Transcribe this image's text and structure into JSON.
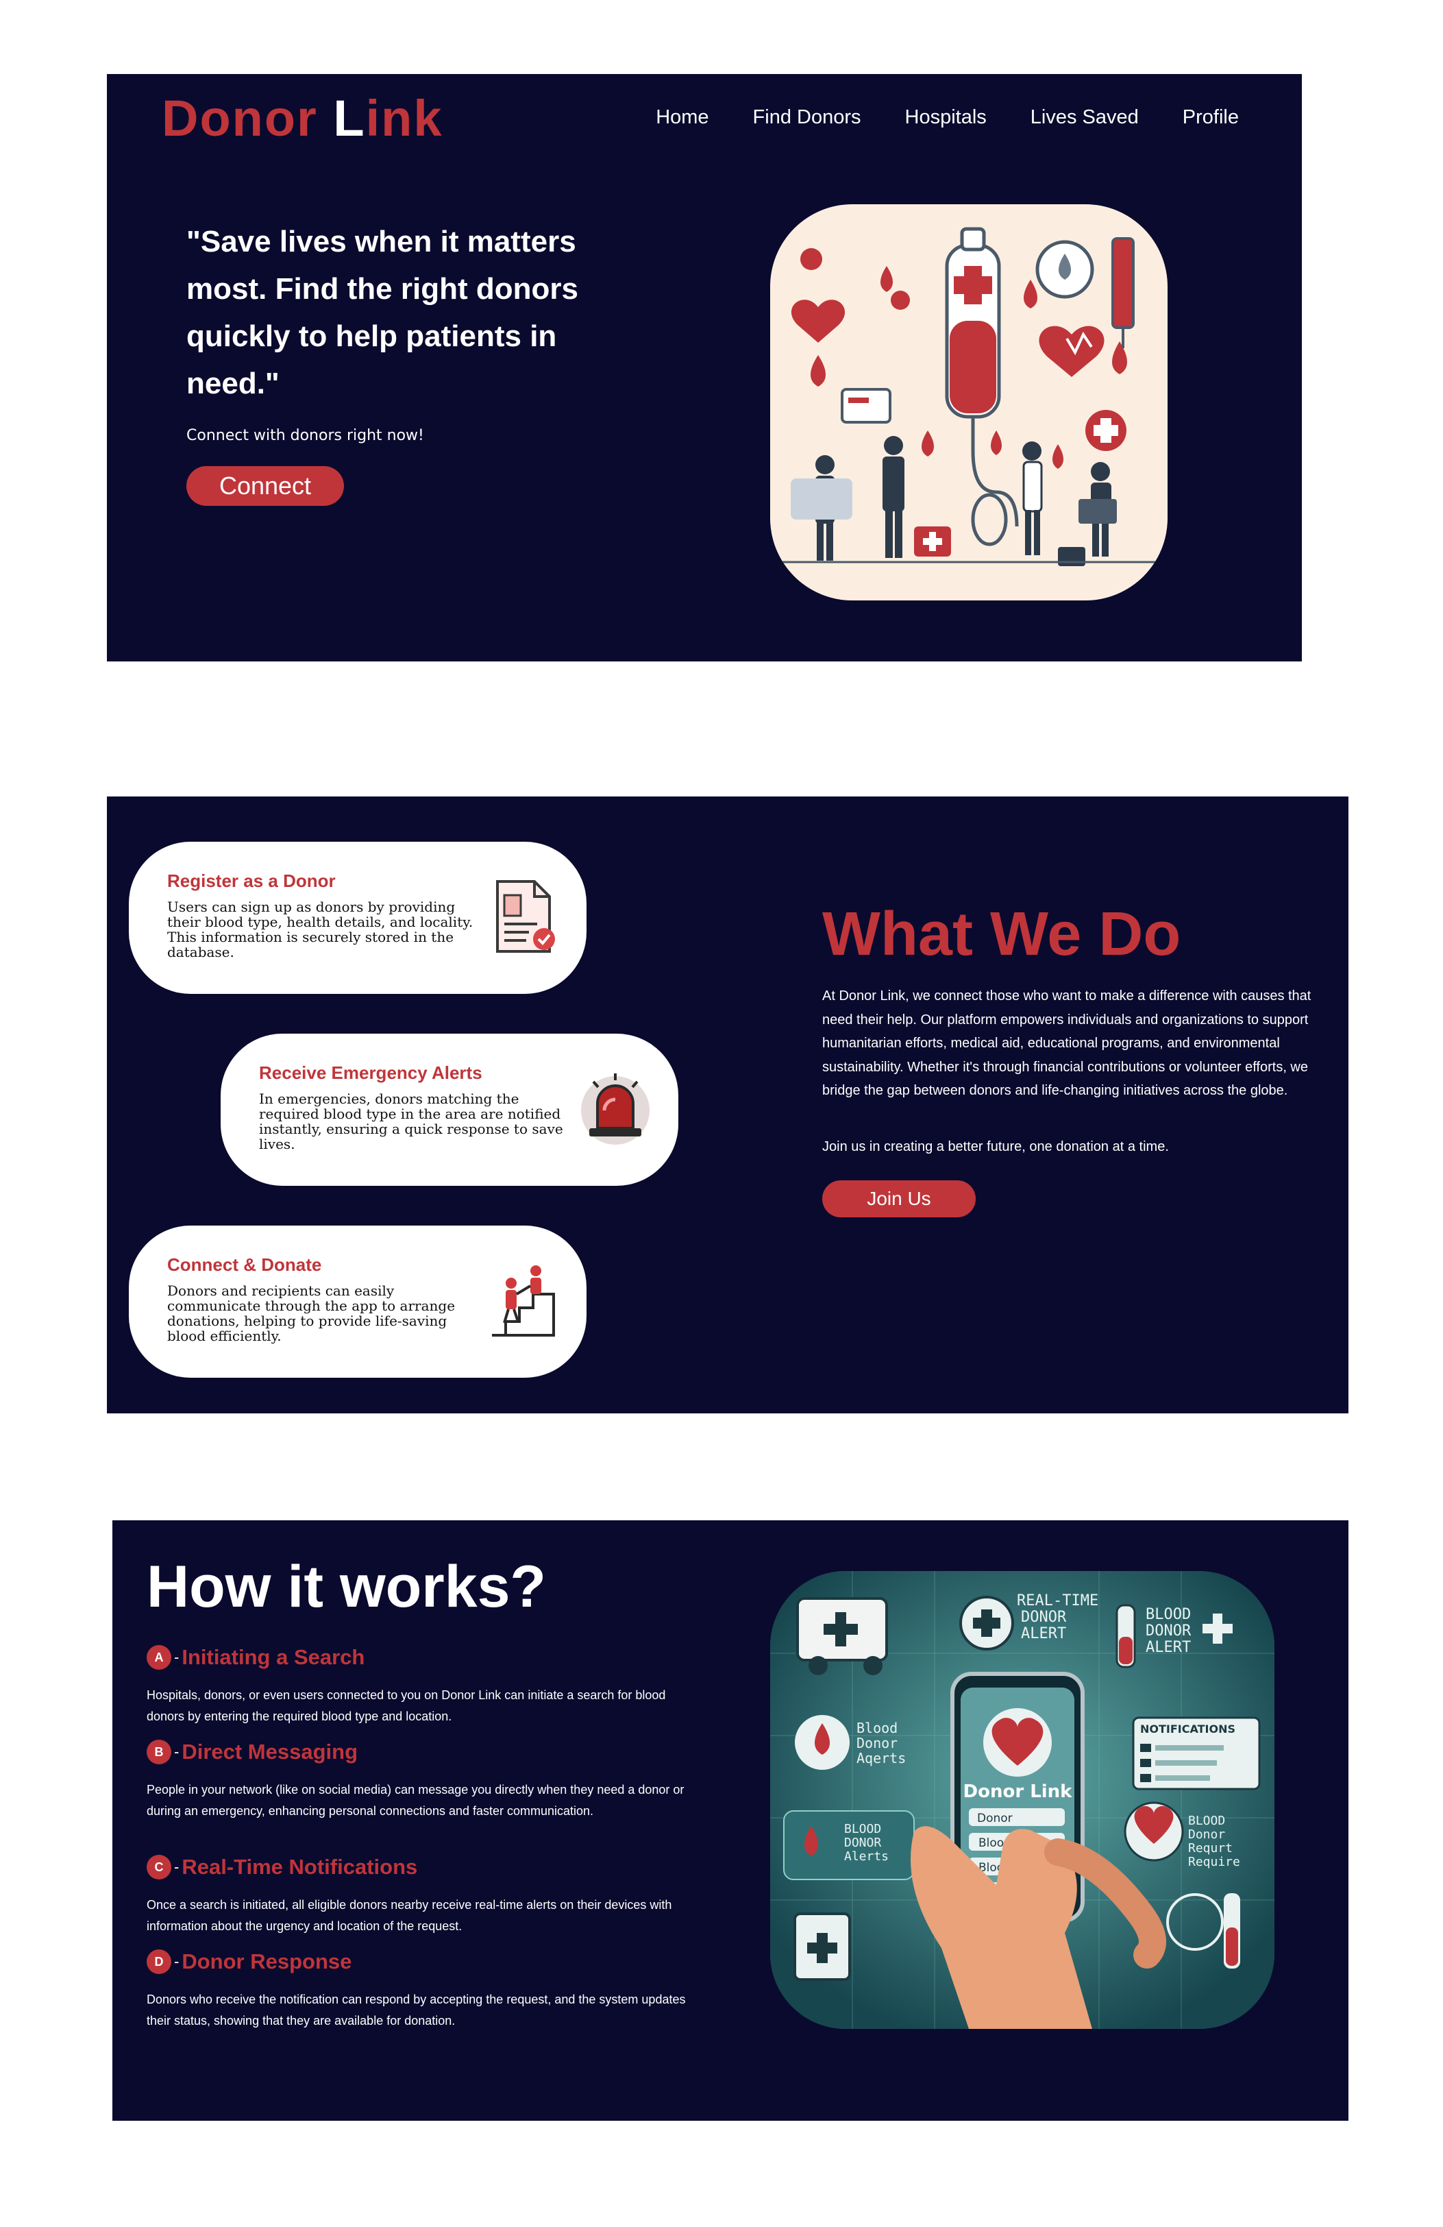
{
  "brand": {
    "part1": "Donor ",
    "part2": "L",
    "part3": "ink"
  },
  "nav": [
    "Home",
    "Find Donors",
    "Hospitals",
    "Lives Saved",
    "Profile"
  ],
  "hero": {
    "quote": "\"Save lives when it matters most. Find the right donors quickly to help patients in need.\"",
    "subtext": "Connect with donors right now!",
    "button": "Connect"
  },
  "what_we_do": {
    "cards": [
      {
        "title": "Register as a Donor",
        "text": "Users can sign up as donors by providing their blood type, health details, and locality. This information is securely stored in the database.",
        "icon": "document-check-icon"
      },
      {
        "title": "Receive Emergency Alerts",
        "text": "In emergencies, donors matching the required blood type in the area are notified instantly, ensuring a quick response to save lives.",
        "icon": "siren-icon"
      },
      {
        "title": "Connect & Donate",
        "text": "Donors and recipients can easily communicate through the app to arrange donations, helping to provide life-saving blood efficiently.",
        "icon": "climbing-people-icon"
      }
    ],
    "title": "What We Do",
    "paragraph": "At Donor Link, we connect those who want to make a difference with causes that need their help. Our platform empowers individuals and organizations to support humanitarian efforts, medical aid, educational programs, and environmental sustainability. Whether it's through financial contributions or volunteer efforts, we bridge the gap between donors and life-changing initiatives across the globe.",
    "join_text": "Join us in creating a better future, one donation at a time.",
    "button": "Join Us"
  },
  "how_it_works": {
    "title": "How it works?",
    "steps": [
      {
        "letter": "A",
        "title": "Initiating a Search",
        "text": "Hospitals, donors, or even users connected to you on Donor Link can initiate a search for blood donors by entering the required blood type and location."
      },
      {
        "letter": "B",
        "title": "Direct Messaging",
        "text": "People in your network (like on social media) can message you directly when they need a donor or during an emergency, enhancing personal connections and faster communication."
      },
      {
        "letter": "C",
        "title": "Real-Time Notifications",
        "text": "Once a search is initiated, all eligible donors nearby receive real-time alerts on their devices with information about the urgency and location of the request."
      },
      {
        "letter": "D",
        "title": "Donor Response",
        "text": "Donors who receive the notification can respond by accepting the request, and the system updates their status, showing that they are available for donation."
      }
    ],
    "illustration_labels": {
      "realtime": "REAL-TIME DONOR ALERT",
      "blood_alert": "BLOOD DONOR ALERT",
      "notifications": "NOTIFICATIONS",
      "left1": "Blood Donor Aqerts",
      "left2": "BLOOD DONOR Alerts",
      "right": "BLOOD Donor Requrt Require",
      "app_name": "Donor Link",
      "field1": "Donor",
      "field2": "Blood Type",
      "field3": "Blood Type",
      "field4": "Blood"
    }
  },
  "colors": {
    "navy": "#0a0a2e",
    "accent_red": "#c0353a",
    "white": "#ffffff"
  }
}
